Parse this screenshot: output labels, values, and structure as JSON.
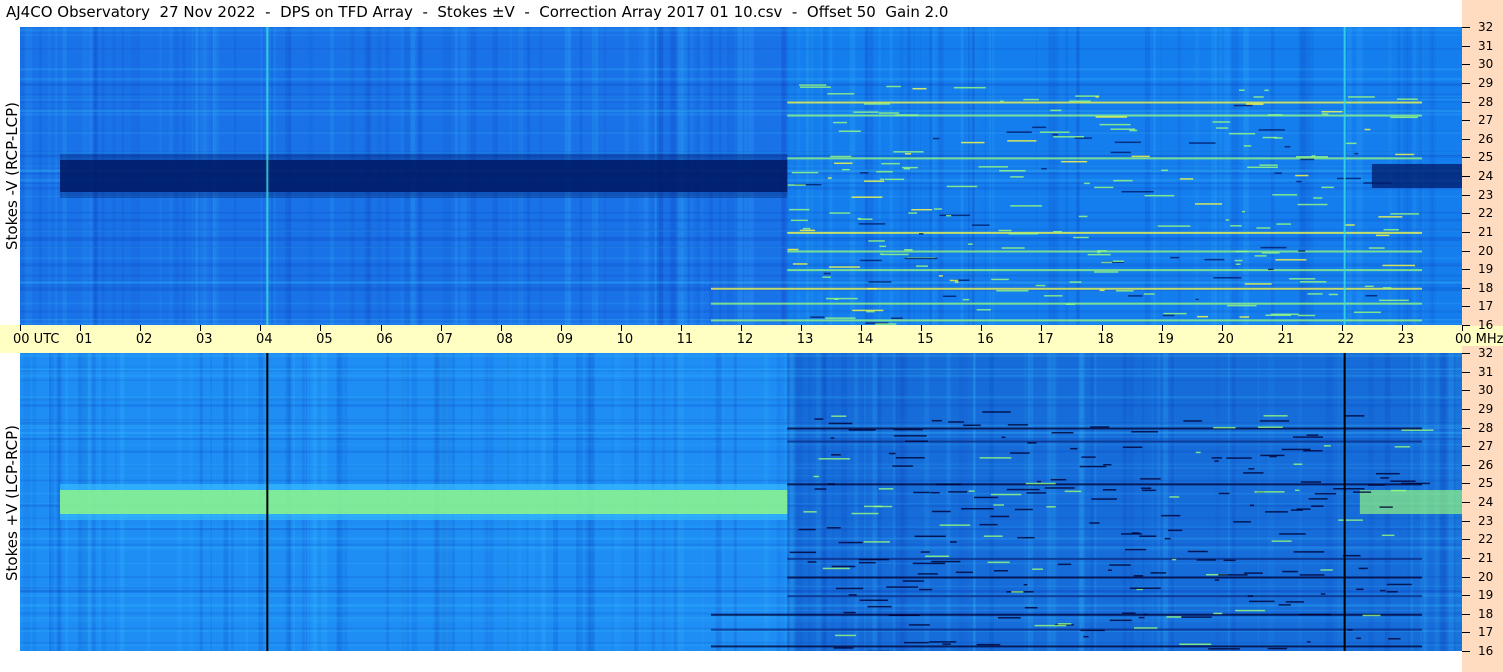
{
  "title": "AJ4CO Observatory  27 Nov 2022  -  DPS on TFD Array  -  Stokes ±V  -  Correction Array 2017 01 10.csv  -  Offset 50  Gain 2.0",
  "chart_data": [
    {
      "type": "heatmap",
      "name": "top-panel",
      "ylabel": "Stokes -V (RCP-LCP)",
      "x_unit": "UTC",
      "y_unit": "MHz",
      "x_ticks": [
        "00",
        "01",
        "02",
        "03",
        "04",
        "05",
        "06",
        "07",
        "08",
        "09",
        "10",
        "11",
        "12",
        "13",
        "14",
        "15",
        "16",
        "17",
        "18",
        "19",
        "20",
        "21",
        "22",
        "23",
        "00"
      ],
      "y_ticks": [
        "32",
        "31",
        "30",
        "29",
        "28",
        "27",
        "26",
        "25",
        "24",
        "23",
        "22",
        "21",
        "20",
        "19",
        "18",
        "17",
        "16"
      ],
      "ylim": [
        16,
        32
      ],
      "xlim": [
        0,
        24
      ],
      "colormap": [
        "#00008a",
        "#0a3cb8",
        "#1a72e8",
        "#1e9aff",
        "#38c2ff",
        "#9aff7a",
        "#ffff40",
        "#ff4040"
      ],
      "background_color": "#1a72e8",
      "features": {
        "dark_band_mhz": 24,
        "bright_band_mhz": null,
        "vertical_line_hours": [
          4.1,
          22.03
        ],
        "regime_change_hour": 12.77
      }
    },
    {
      "type": "heatmap",
      "name": "bottom-panel",
      "ylabel": "Stokes +V (LCP-RCP)",
      "x_unit": "UTC",
      "y_unit": "MHz",
      "x_ticks": [
        "00",
        "01",
        "02",
        "03",
        "04",
        "05",
        "06",
        "07",
        "08",
        "09",
        "10",
        "11",
        "12",
        "13",
        "14",
        "15",
        "16",
        "17",
        "18",
        "19",
        "20",
        "21",
        "22",
        "23",
        "00"
      ],
      "y_ticks": [
        "32",
        "31",
        "30",
        "29",
        "28",
        "27",
        "26",
        "25",
        "24",
        "23",
        "22",
        "21",
        "20",
        "19",
        "18",
        "17",
        "16"
      ],
      "ylim": [
        16,
        32
      ],
      "xlim": [
        0,
        24
      ],
      "background_color": "#1e8ef5",
      "features": {
        "dark_band_mhz": null,
        "bright_band_mhz": 24,
        "vertical_line_hours": [
          4.1,
          22.03
        ],
        "regime_change_hour": 12.77
      }
    }
  ],
  "time_axis": {
    "start_label": "00  UTC",
    "end_label": "00 MHz"
  }
}
